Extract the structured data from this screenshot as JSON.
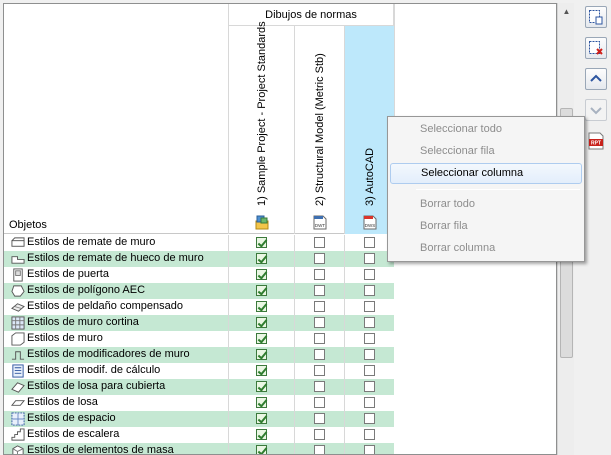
{
  "group_header": "Dibujos de normas",
  "objects_header": "Objetos",
  "columns": [
    {
      "label": "1) Sample Project - Project Standards",
      "icon": "project-standards-icon"
    },
    {
      "label": "2) Structural Model (Metric Stb)",
      "icon": "dwt-file-icon",
      "icon_text": "DWT"
    },
    {
      "label": "3) AutoCAD",
      "icon": "dws-file-icon",
      "icon_text": "DWS"
    }
  ],
  "rows": [
    {
      "label": "Estilos de remate de muro",
      "icon": "wall-endcap-style-icon",
      "checks": [
        true,
        false,
        false
      ]
    },
    {
      "label": "Estilos de remate de hueco de muro",
      "icon": "opening-endcap-style-icon",
      "checks": [
        true,
        false,
        false
      ]
    },
    {
      "label": "Estilos de puerta",
      "icon": "door-style-icon",
      "checks": [
        true,
        false,
        false
      ]
    },
    {
      "label": "Estilos de polígono AEC",
      "icon": "aec-polygon-style-icon",
      "checks": [
        true,
        false,
        false
      ]
    },
    {
      "label": "Estilos de peldaño compensado",
      "icon": "winder-style-icon",
      "checks": [
        true,
        false,
        false
      ]
    },
    {
      "label": "Estilos de muro cortina",
      "icon": "curtain-wall-style-icon",
      "checks": [
        true,
        false,
        false
      ]
    },
    {
      "label": "Estilos de muro",
      "icon": "wall-style-icon",
      "checks": [
        true,
        false,
        false
      ]
    },
    {
      "label": "Estilos de modificadores de muro",
      "icon": "wall-modifier-style-icon",
      "checks": [
        true,
        false,
        false
      ]
    },
    {
      "label": "Estilos de modif. de cálculo",
      "icon": "calculation-modifier-style-icon",
      "checks": [
        true,
        false,
        false
      ]
    },
    {
      "label": "Estilos de losa para cubierta",
      "icon": "roof-slab-style-icon",
      "checks": [
        true,
        false,
        false
      ]
    },
    {
      "label": "Estilos de losa",
      "icon": "slab-style-icon",
      "checks": [
        true,
        false,
        false
      ]
    },
    {
      "label": "Estilos de espacio",
      "icon": "space-style-icon",
      "checks": [
        true,
        false,
        false
      ]
    },
    {
      "label": "Estilos de escalera",
      "icon": "stair-style-icon",
      "checks": [
        true,
        false,
        false
      ]
    },
    {
      "label": "Estilos de elementos de masa",
      "icon": "mass-element-style-icon",
      "checks": [
        true,
        false,
        false
      ]
    }
  ],
  "context_menu": {
    "items": [
      {
        "label": "Seleccionar todo",
        "enabled": false
      },
      {
        "label": "Seleccionar fila",
        "enabled": false
      },
      {
        "label": "Seleccionar columna",
        "enabled": true,
        "highlighted": true
      },
      {
        "label": "Borrar todo",
        "enabled": false
      },
      {
        "label": "Borrar fila",
        "enabled": false
      },
      {
        "label": "Borrar columna",
        "enabled": false
      }
    ]
  },
  "toolbar": [
    {
      "name": "add-standards-file-button",
      "icon": "add-file-icon",
      "enabled": true
    },
    {
      "name": "remove-standards-file-button",
      "icon": "remove-file-icon",
      "enabled": true
    },
    {
      "name": "move-up-button",
      "icon": "move-up-icon",
      "enabled": true
    },
    {
      "name": "move-down-button",
      "icon": "move-down-icon",
      "enabled": false
    },
    {
      "name": "report-button",
      "icon": "report-icon",
      "icon_text": "RPT",
      "enabled": true
    }
  ],
  "colors": {
    "alt_row": "#c5e8d3",
    "selected_column": "#bde8fb",
    "menu_highlight_border": "#aeccef",
    "check_green": "#2f7d2f"
  }
}
